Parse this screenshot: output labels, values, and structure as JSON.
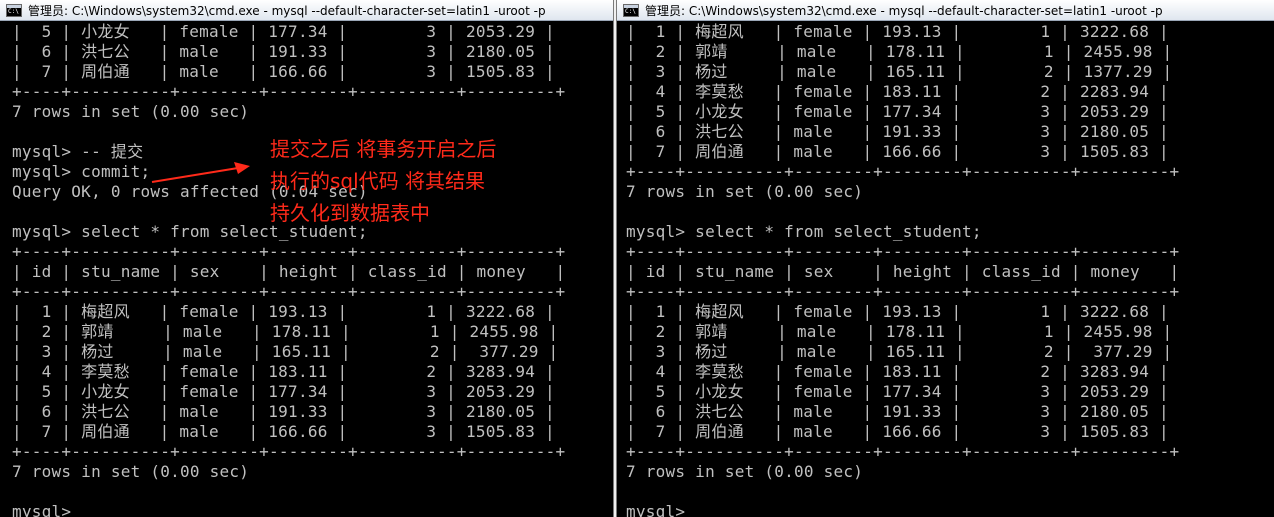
{
  "left_window": {
    "title": "管理员: C:\\Windows\\system32\\cmd.exe - mysql  --default-character-set=latin1 -uroot -p",
    "lines": [
      "|  5 | 小龙女   | female | 177.34 |        3 | 2053.29 |",
      "|  6 | 洪七公   | male   | 191.33 |        3 | 2180.05 |",
      "|  7 | 周伯通   | male   | 166.66 |        3 | 1505.83 |",
      "+----+----------+--------+--------+----------+---------+",
      "7 rows in set (0.00 sec)",
      "",
      "mysql> -- 提交",
      "mysql> commit;",
      "Query OK, 0 rows affected (0.04 sec)",
      "",
      "mysql> select * from select_student;",
      "+----+----------+--------+--------+----------+---------+",
      "| id | stu_name | sex    | height | class_id | money   |",
      "+----+----------+--------+--------+----------+---------+",
      "|  1 | 梅超风   | female | 193.13 |        1 | 3222.68 |",
      "|  2 | 郭靖     | male   | 178.11 |        1 | 2455.98 |",
      "|  3 | 杨过     | male   | 165.11 |        2 |  377.29 |",
      "|  4 | 李莫愁   | female | 183.11 |        2 | 3283.94 |",
      "|  5 | 小龙女   | female | 177.34 |        3 | 2053.29 |",
      "|  6 | 洪七公   | male   | 191.33 |        3 | 2180.05 |",
      "|  7 | 周伯通   | male   | 166.66 |        3 | 1505.83 |",
      "+----+----------+--------+--------+----------+---------+",
      "7 rows in set (0.00 sec)",
      "",
      "mysql>"
    ]
  },
  "right_window": {
    "title": "管理员: C:\\Windows\\system32\\cmd.exe - mysql  --default-character-set=latin1 -uroot -p",
    "lines": [
      "|  1 | 梅超风   | female | 193.13 |        1 | 3222.68 |",
      "|  2 | 郭靖     | male   | 178.11 |        1 | 2455.98 |",
      "|  3 | 杨过     | male   | 165.11 |        2 | 1377.29 |",
      "|  4 | 李莫愁   | female | 183.11 |        2 | 2283.94 |",
      "|  5 | 小龙女   | female | 177.34 |        3 | 2053.29 |",
      "|  6 | 洪七公   | male   | 191.33 |        3 | 2180.05 |",
      "|  7 | 周伯通   | male   | 166.66 |        3 | 1505.83 |",
      "+----+----------+--------+--------+----------+---------+",
      "7 rows in set (0.00 sec)",
      "",
      "mysql> select * from select_student;",
      "+----+----------+--------+--------+----------+---------+",
      "| id | stu_name | sex    | height | class_id | money   |",
      "+----+----------+--------+--------+----------+---------+",
      "|  1 | 梅超风   | female | 193.13 |        1 | 3222.68 |",
      "|  2 | 郭靖     | male   | 178.11 |        1 | 2455.98 |",
      "|  3 | 杨过     | male   | 165.11 |        2 |  377.29 |",
      "|  4 | 李莫愁   | female | 183.11 |        2 | 3283.94 |",
      "|  5 | 小龙女   | female | 177.34 |        3 | 2053.29 |",
      "|  6 | 洪七公   | male   | 191.33 |        3 | 2180.05 |",
      "|  7 | 周伯通   | male   | 166.66 |        3 | 1505.83 |",
      "+----+----------+--------+--------+----------+---------+",
      "7 rows in set (0.00 sec)",
      "",
      "mysql>"
    ]
  },
  "annotation": {
    "lines": [
      "提交之后 将事务开启之后",
      "执行的sql代码 将其结果",
      "持久化到数据表中"
    ],
    "color": "#ff2a1a"
  },
  "icons": {
    "window_icon": "cmd-console-icon"
  }
}
